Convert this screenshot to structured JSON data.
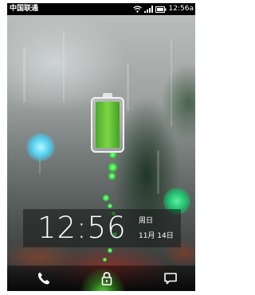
{
  "status_bar": {
    "carrier": "中国联通",
    "time": "12:56a",
    "icons": [
      "wifi-icon",
      "signal-icon",
      "battery-icon"
    ]
  },
  "lock_screen": {
    "charging_level": 1.0,
    "time": "12:56",
    "weekday": "周日",
    "date": "11月 14日",
    "accent_color": "#2ee03a"
  },
  "dock": {
    "buttons": [
      "phone-icon",
      "lock-icon",
      "message-icon"
    ]
  }
}
